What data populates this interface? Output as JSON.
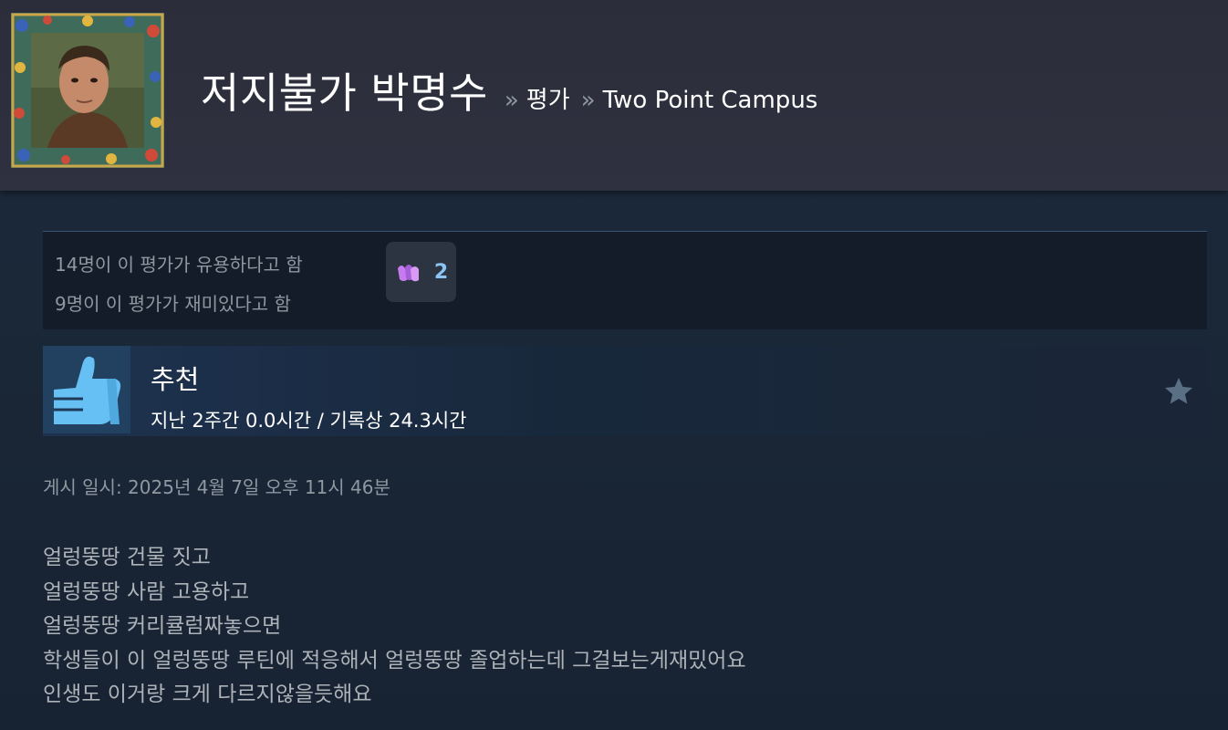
{
  "header": {
    "user_name": "저지불가 박명수",
    "breadcrumb_sep": "»",
    "breadcrumb_reviews": "평가",
    "breadcrumb_game": "Two Point Campus"
  },
  "rating": {
    "helpful": "14명이 이 평가가 유용하다고 함",
    "funny": "9명이 이 평가가 재미있다고 함",
    "award_count": "2",
    "award_icon": "clapping-hands-icon",
    "award_color": "#c77bf0"
  },
  "recommendation": {
    "label": "추천",
    "hours": "지난 2주간 0.0시간 / 기록상 24.3시간",
    "icon": "thumbs-up-icon",
    "icon_color": "#66c0f4"
  },
  "posted": "게시 일시: 2025년 4월 7일 오후 11시 46분",
  "review": {
    "lines": [
      "얼렁뚱땅 건물 짓고",
      "얼렁뚱땅 사람 고용하고",
      "얼렁뚱땅 커리큘럼짜놓으면",
      "학생들이 이 얼렁뚱땅 루틴에 적응해서 얼렁뚱땅 졸업하는데 그걸보는게재밌어요",
      "인생도 이거랑 크게 다르지않을듯해요"
    ]
  }
}
